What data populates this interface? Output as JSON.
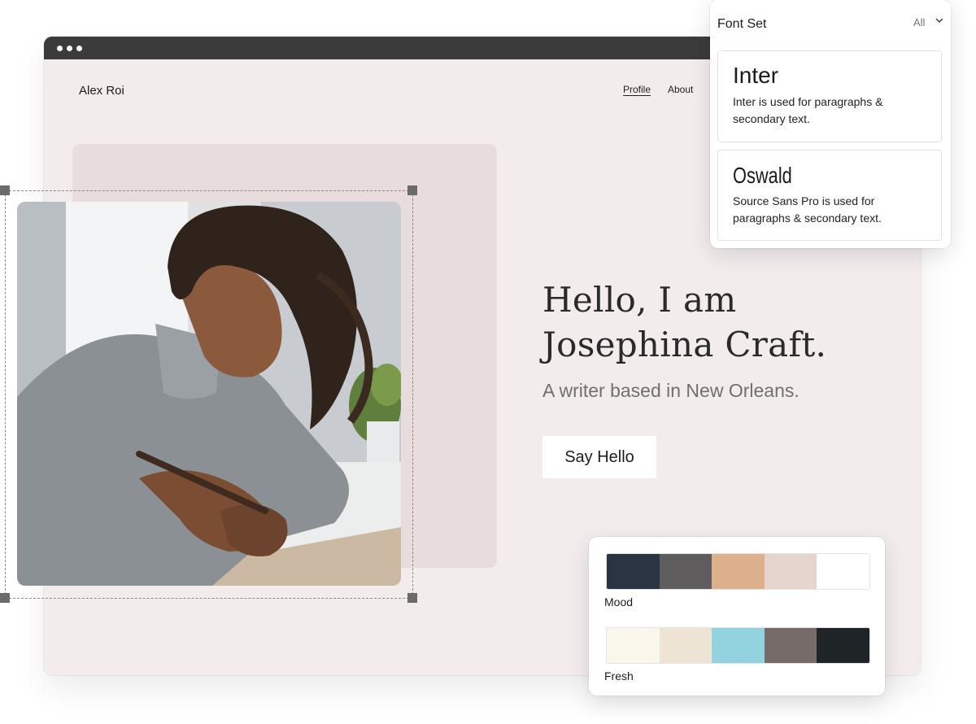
{
  "site": {
    "brand": "Alex Roi",
    "nav": [
      {
        "label": "Profile"
      },
      {
        "label": "About"
      }
    ],
    "hero": {
      "title": "Hello, I am\nJosephina Craft.",
      "subtitle": "A writer based in New Orleans.",
      "button": "Say Hello"
    }
  },
  "font_panel": {
    "title": "Font Set",
    "filter": "All",
    "fonts": [
      {
        "name": "Inter",
        "description": "Inter is used for paragraphs & secondary text."
      },
      {
        "name": "Oswald",
        "description": "Source Sans Pro is used for paragraphs & secondary text."
      }
    ]
  },
  "palettes": [
    {
      "name": "Mood",
      "colors": [
        "#2b3442",
        "#5e5c5d",
        "#ddb08c",
        "#e6d5cf",
        "#ffffff"
      ]
    },
    {
      "name": "Fresh",
      "colors": [
        "#f9f6ec",
        "#ede4d3",
        "#92d3df",
        "#776b69",
        "#1f2427"
      ]
    }
  ]
}
